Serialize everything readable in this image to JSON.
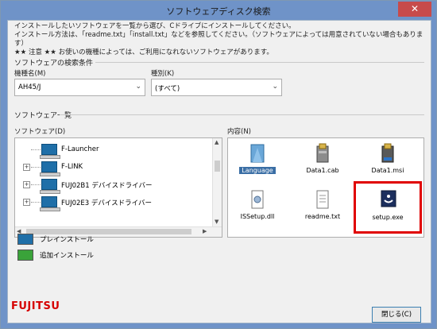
{
  "window": {
    "title": "ソフトウェアディスク検索",
    "close_glyph": "✕"
  },
  "intro": {
    "line1": "インストールしたいソフトウェアを一覧から選び、Cドライブにインストールしてください。",
    "line2": "インストール方法は、「readme.txt」「install.txt」などを参照してください。（ソフトウェアによっては用意されていない場合もあります）",
    "line3": "★★ 注意 ★★ お使いの機種によっては、ご利用になれないソフトウェアがあります。"
  },
  "search": {
    "group_label": "ソフトウェアの検索条件",
    "model_label": "機種名(M)",
    "model_value": "AH45/J",
    "type_label": "種別(K)",
    "type_value": "(すべて)"
  },
  "list": {
    "group_label": "ソフトウェア一覧",
    "software_label": "ソフトウェア(D)",
    "content_label": "内容(N)",
    "tree": [
      {
        "label": "F-Launcher",
        "expander": ""
      },
      {
        "label": "F-LINK",
        "expander": "+"
      },
      {
        "label": "FUJ02B1 デバイスドライバー",
        "expander": "+"
      },
      {
        "label": "FUJ02E3 デバイスドライバー",
        "expander": "+"
      }
    ],
    "files": [
      {
        "name": "Language",
        "icon": "folder-icon"
      },
      {
        "name": "Data1.cab",
        "icon": "cab-icon"
      },
      {
        "name": "Data1.msi",
        "icon": "msi-icon"
      },
      {
        "name": "ISSetup.dll",
        "icon": "dll-icon"
      },
      {
        "name": "readme.txt",
        "icon": "text-file-icon"
      },
      {
        "name": "setup.exe",
        "icon": "setup-exe-icon"
      }
    ]
  },
  "legend": {
    "preinstall": "プレインストール",
    "additional": "追加インストール"
  },
  "footer": {
    "logo": "FUJITSU",
    "close_button": "閉じる(C)"
  },
  "colors": {
    "highlight": "#e00000",
    "selected_file_bg": "#3a6ea5",
    "preinstall_icon": "#1f6fa8",
    "additional_icon": "#3aa33a"
  }
}
